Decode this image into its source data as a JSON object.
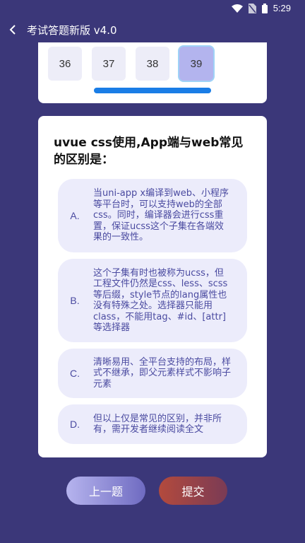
{
  "status_bar": {
    "time": "5:29",
    "icons": [
      "wifi-icon",
      "sim-icon",
      "battery-icon"
    ]
  },
  "app_bar": {
    "title": "考试答题新版 v4.0",
    "back_icon": "chevron-left-icon"
  },
  "question_nav": {
    "numbers": [
      "36",
      "37",
      "38",
      "39"
    ],
    "active": "39",
    "progress": 1.0
  },
  "question": {
    "text": "uvue css使用,App端与web常见的区别是：",
    "options": [
      {
        "letter": "A.",
        "text": "当uni-app x编译到web、小程序等平台时，可以支持web的全部css。同时，编译器会进行css重置，保证ucss这个子集在各端效果的一致性。"
      },
      {
        "letter": "B.",
        "text": "这个子集有时也被称为ucss，但工程文件仍然是css、less、scss等后缀，style节点的lang属性也没有特殊之处。选择器只能用class，不能用tag、#id、[attr]等选择器"
      },
      {
        "letter": "C.",
        "text": "清晰易用、全平台支持的布局，样式不继承，即父元素样式不影响子元素"
      },
      {
        "letter": "D.",
        "text": "但以上仅是常见的区别，并非所有，需开发者继续阅读全文"
      }
    ]
  },
  "buttons": {
    "prev": "上一题",
    "submit": "提交"
  },
  "colors": {
    "background": "#3b3779",
    "option_bg": "#ececfb",
    "progress": "#1a7de6",
    "active_num": "#b3b4ee"
  }
}
